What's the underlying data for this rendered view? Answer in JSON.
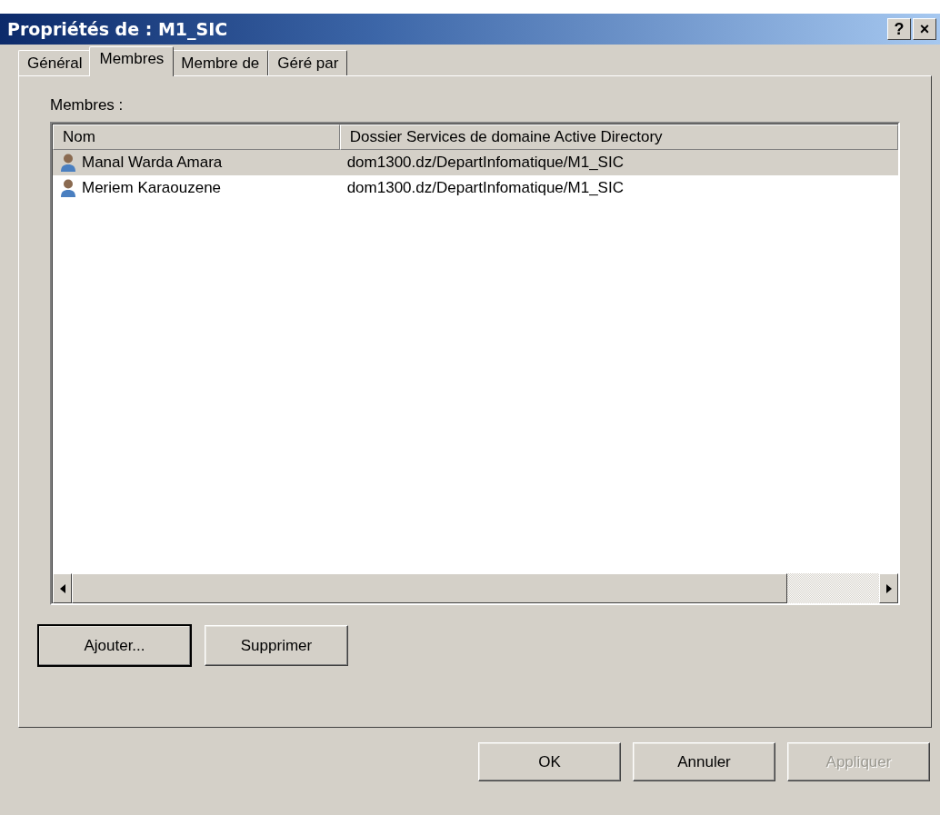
{
  "window": {
    "title": "Propriétés de : M1_SIC",
    "help_button": "?",
    "close_button": "×"
  },
  "tabs": [
    {
      "label": "Général",
      "selected": false
    },
    {
      "label": "Membres",
      "selected": true
    },
    {
      "label": "Membre de",
      "selected": false
    },
    {
      "label": "Géré par",
      "selected": false
    }
  ],
  "members_label": "Membres :",
  "table": {
    "columns": [
      "Nom",
      "Dossier Services de domaine Active Directory"
    ],
    "rows": [
      {
        "name": "Manal Warda Amara",
        "folder": "dom1300.dz/DepartInfomatique/M1_SIC",
        "selected": true
      },
      {
        "name": "Meriem Karaouzene",
        "folder": "dom1300.dz/DepartInfomatique/M1_SIC",
        "selected": false
      }
    ]
  },
  "list_buttons": [
    {
      "label": "Ajouter...",
      "default": true
    },
    {
      "label": "Supprimer",
      "default": false
    }
  ],
  "dialog_buttons": [
    {
      "label": "OK",
      "disabled": false
    },
    {
      "label": "Annuler",
      "disabled": false
    },
    {
      "label": "Appliquer",
      "disabled": true
    }
  ]
}
